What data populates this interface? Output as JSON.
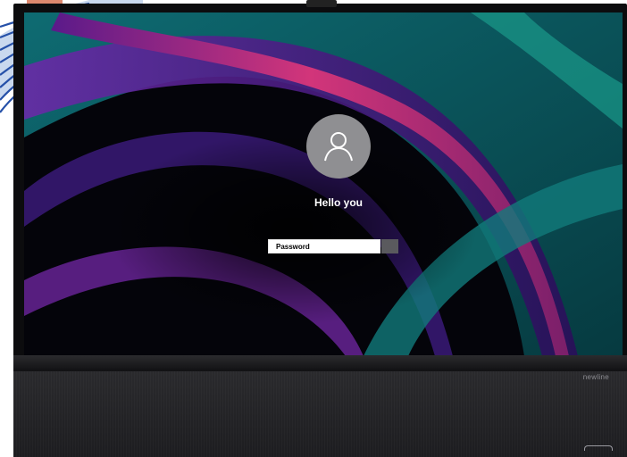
{
  "lock_screen": {
    "greeting": "Hello you",
    "password_placeholder": "Password"
  },
  "device": {
    "brand": "newline"
  },
  "icons": {
    "avatar": "user-silhouette-icon",
    "submit": "arrow-right-icon"
  },
  "colors": {
    "avatar_bg": "#8f8f92",
    "submit_bg": "#5a5a5e",
    "bezel": "#0c0c0e"
  }
}
